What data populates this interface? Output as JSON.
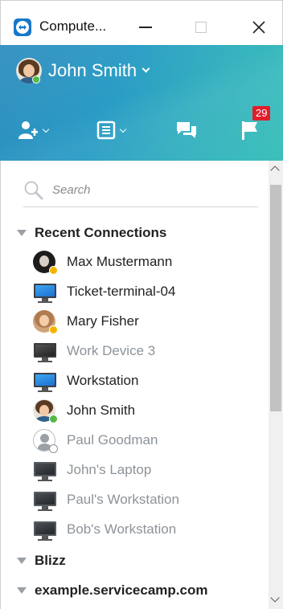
{
  "window": {
    "title": "Compute..."
  },
  "profile": {
    "name": "John Smith"
  },
  "toolbar": {
    "notifications_count": "29"
  },
  "search": {
    "placeholder": "Search"
  },
  "groups": [
    {
      "label": "Recent Connections",
      "expanded": true
    },
    {
      "label": "Blizz",
      "expanded": true
    },
    {
      "label": "example.servicecamp.com",
      "expanded": true
    }
  ],
  "recent_connections": [
    {
      "label": "Max Mustermann",
      "type": "contact",
      "status": "away"
    },
    {
      "label": "Ticket-terminal-04",
      "type": "computer",
      "status": "online"
    },
    {
      "label": "Mary Fisher",
      "type": "contact",
      "status": "away"
    },
    {
      "label": "Work Device 3",
      "type": "computer",
      "status": "offline"
    },
    {
      "label": "Workstation",
      "type": "computer",
      "status": "online"
    },
    {
      "label": "John Smith",
      "type": "contact",
      "status": "online"
    },
    {
      "label": "Paul Goodman",
      "type": "contact",
      "status": "offline"
    },
    {
      "label": "John's Laptop",
      "type": "computer",
      "status": "offline"
    },
    {
      "label": "Paul's Workstation",
      "type": "computer",
      "status": "offline"
    },
    {
      "label": "Bob's Workstation",
      "type": "computer",
      "status": "offline"
    }
  ],
  "colors": {
    "header_start": "#2e8dbe",
    "header_end": "#3cc0bb",
    "badge": "#e11d2a",
    "online": "#56b947",
    "away": "#f5b400",
    "offline_text": "#8d9399"
  }
}
